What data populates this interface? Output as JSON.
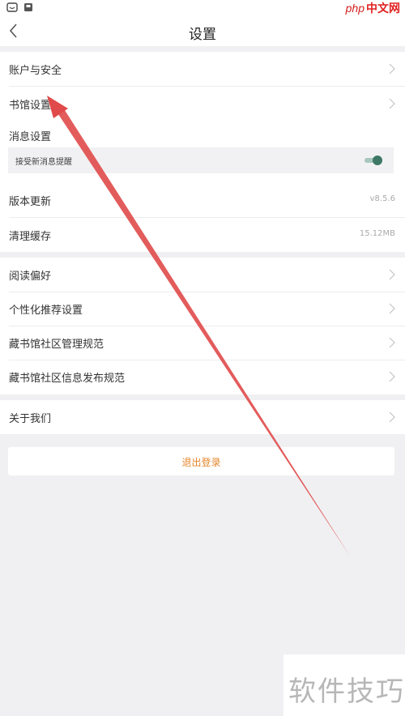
{
  "status_bar": {
    "icons": [
      "chat-app-icon",
      "notification-icon"
    ]
  },
  "watermark_top": {
    "php_text": "php",
    "site_text": "中文网"
  },
  "header": {
    "title": "设置",
    "back_icon": "chevron-left-icon"
  },
  "settings": {
    "account_security": "账户与安全",
    "library_settings": "书馆设置",
    "message_settings": "消息设置",
    "receive_new_message_alerts": "接受新消息提醒",
    "app_version_label": "版本更新",
    "app_version_value": "v8.5.6",
    "clear_cache_label": "清理缓存",
    "clear_cache_value": "15.12MB",
    "reading_preferences": "阅读偏好",
    "personalized_recommendation": "个性化推荐设置",
    "community_management_rules": "藏书馆社区管理规范",
    "community_posting_rules": "藏书馆社区信息发布规范",
    "about_us": "关于我们"
  },
  "toggle_state": "on",
  "logout": {
    "label": "退出登录"
  },
  "watermark_bottom": {
    "text": "软件技巧"
  },
  "colors": {
    "accent": "#e6862b",
    "toggle": "#3e7766",
    "arrow": "#e04a4a",
    "background": "#f0f0f2"
  }
}
